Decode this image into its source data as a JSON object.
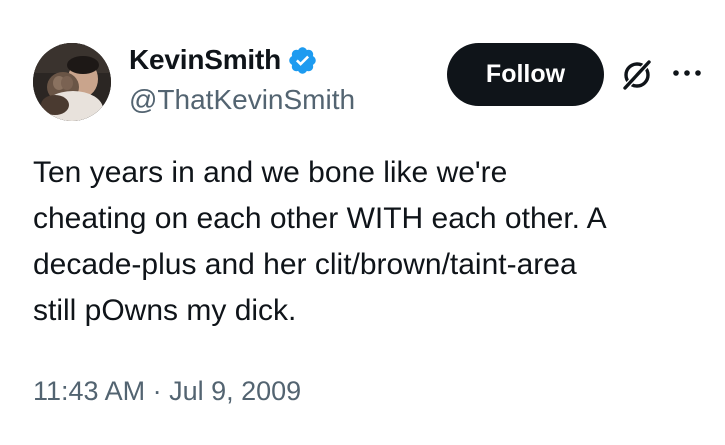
{
  "author": {
    "display_name": "KevinSmith",
    "handle": "@ThatKevinSmith",
    "verified": true,
    "verified_color": "#1d9bf0",
    "avatar_icon": "profile-photo"
  },
  "actions": {
    "follow_label": "Follow",
    "grok_icon": "grok-icon",
    "more_icon": "more-icon"
  },
  "tweet": {
    "text": "Ten years in and we bone like we're\ncheating on each other WITH each other. A\ndecade-plus and her clit/brown/taint-area\nstill pOwns my dick.",
    "timestamp": "11:43 AM · Jul 9, 2009"
  },
  "colors": {
    "text": "#0f1419",
    "secondary_text": "#536471",
    "button_bg": "#0f1419",
    "button_text": "#ffffff"
  }
}
